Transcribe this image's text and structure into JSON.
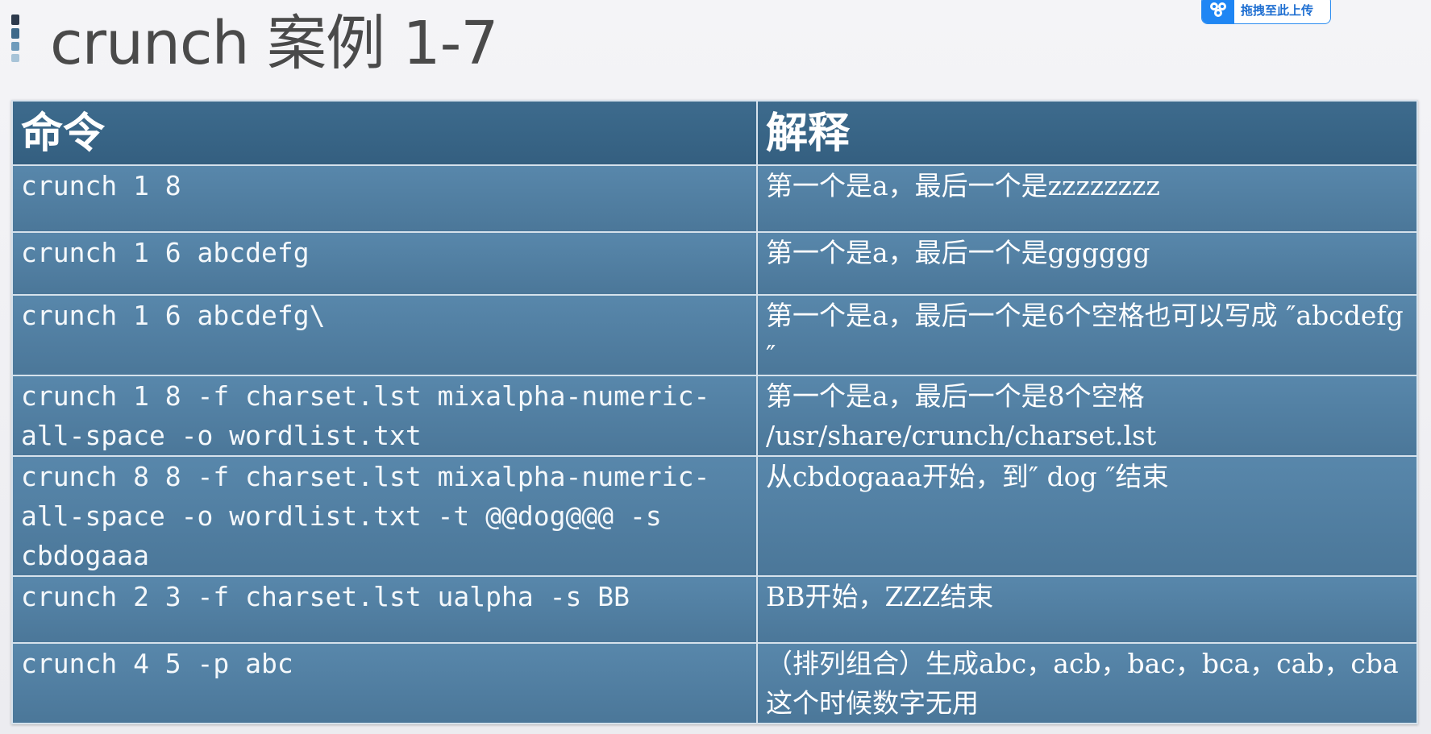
{
  "slide": {
    "title": "crunch 案例 1-7"
  },
  "upload_badge": {
    "label": "拖拽至此上传",
    "icon": "cloud-upload-icon",
    "color": "#1f86f4"
  },
  "table": {
    "headers": [
      "命令",
      "解释"
    ],
    "rows": [
      {
        "command": "crunch 1 8",
        "explanation": "第一个是a，最后一个是zzzzzzzz"
      },
      {
        "command": "crunch 1 6 abcdefg",
        "explanation": "第一个是a，最后一个是gggggg"
      },
      {
        "command": "crunch 1 6 abcdefg\\",
        "explanation": "第一个是a，最后一个是6个空格也可以写成 ″abcdefg ″"
      },
      {
        "command": "crunch 1 8 -f charset.lst mixalpha-numeric-all-space -o wordlist.txt",
        "explanation": "第一个是a，最后一个是8个空格 /usr/share/crunch/charset.lst"
      },
      {
        "command": "crunch 8 8 -f charset.lst mixalpha-numeric-all-space -o wordlist.txt -t @@dog@@@ -s cbdogaaa",
        "explanation": "从cbdogaaa开始，到″  dog   ″结束"
      },
      {
        "command": "crunch 2 3 -f charset.lst ualpha -s BB",
        "explanation": "BB开始，ZZZ结束"
      },
      {
        "command": "crunch 4 5 -p abc",
        "explanation": "（排列组合）生成abc，acb，bac，bca，cab，cba这个时候数字无用"
      }
    ]
  },
  "colors": {
    "header_bg": "#345f80",
    "row_bg": "#5181a4",
    "border": "#d6e2ec",
    "title_text": "#4a4a4a"
  }
}
